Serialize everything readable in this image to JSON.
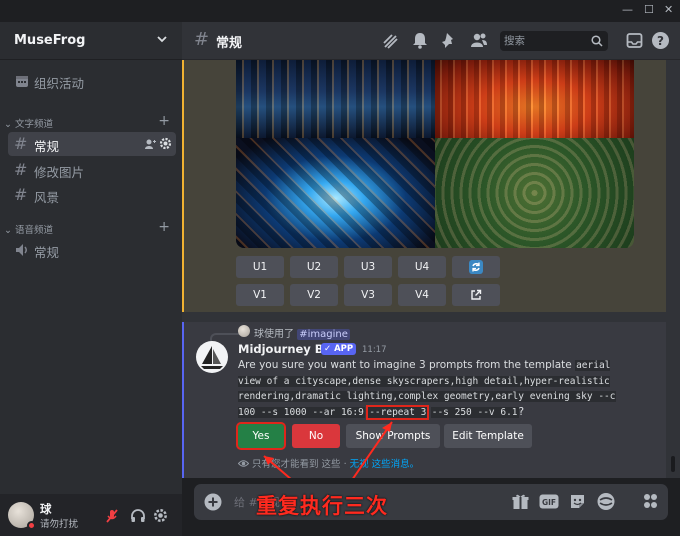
{
  "window": {
    "minimize": "—",
    "maximize": "☐",
    "close": "✕"
  },
  "sidebar": {
    "server_name": "MuseFrog",
    "event_item": "组织活动",
    "text_category": "文字频道",
    "voice_category": "语音频道",
    "text_channels": [
      {
        "name": "常规",
        "active": true
      },
      {
        "name": "修改图片",
        "active": false
      },
      {
        "name": "风景",
        "active": false
      }
    ],
    "voice_channels": [
      {
        "name": "常规"
      }
    ]
  },
  "user": {
    "name": "球",
    "status": "请勿打扰"
  },
  "header": {
    "channel_name": "常规",
    "search_placeholder": "搜索"
  },
  "previous_message": {
    "upscale_buttons": [
      "U1",
      "U2",
      "U3",
      "U4"
    ],
    "variation_buttons": [
      "V1",
      "V2",
      "V3",
      "V4"
    ]
  },
  "message": {
    "reply_user": "球使用了",
    "reply_command": "imagine",
    "bot_name": "Midjourney Bot",
    "app_badge": "APP",
    "time": "11:17",
    "text_before": "Are you sure you want to imagine 3 prompts from the template",
    "code_main": "aerial view of a cityscape,dense skyscrapers,high detail,hyper-realistic rendering,dramatic lighting,complex geometry,early evening sky --c 100 --s 1000 --ar 16:9",
    "code_repeat": "--repeat 3",
    "code_tail": "--s 250 --v 6.1",
    "text_after": "?",
    "buttons": {
      "yes": "Yes",
      "no": "No",
      "show_prompts": "Show Prompts",
      "edit_template": "Edit Template"
    },
    "ephemeral_text": "只有您才能看到 这些 ·",
    "ephemeral_link": "无视 这些消息。"
  },
  "input": {
    "placeholder": "给 #常规"
  },
  "annotation": "重复执行三次",
  "colors": {
    "accent": "#5865f2",
    "yes_button": "#248046",
    "no_button": "#da373c",
    "secondary_button": "#4e5058",
    "annotation_red": "#ff2a1f"
  }
}
